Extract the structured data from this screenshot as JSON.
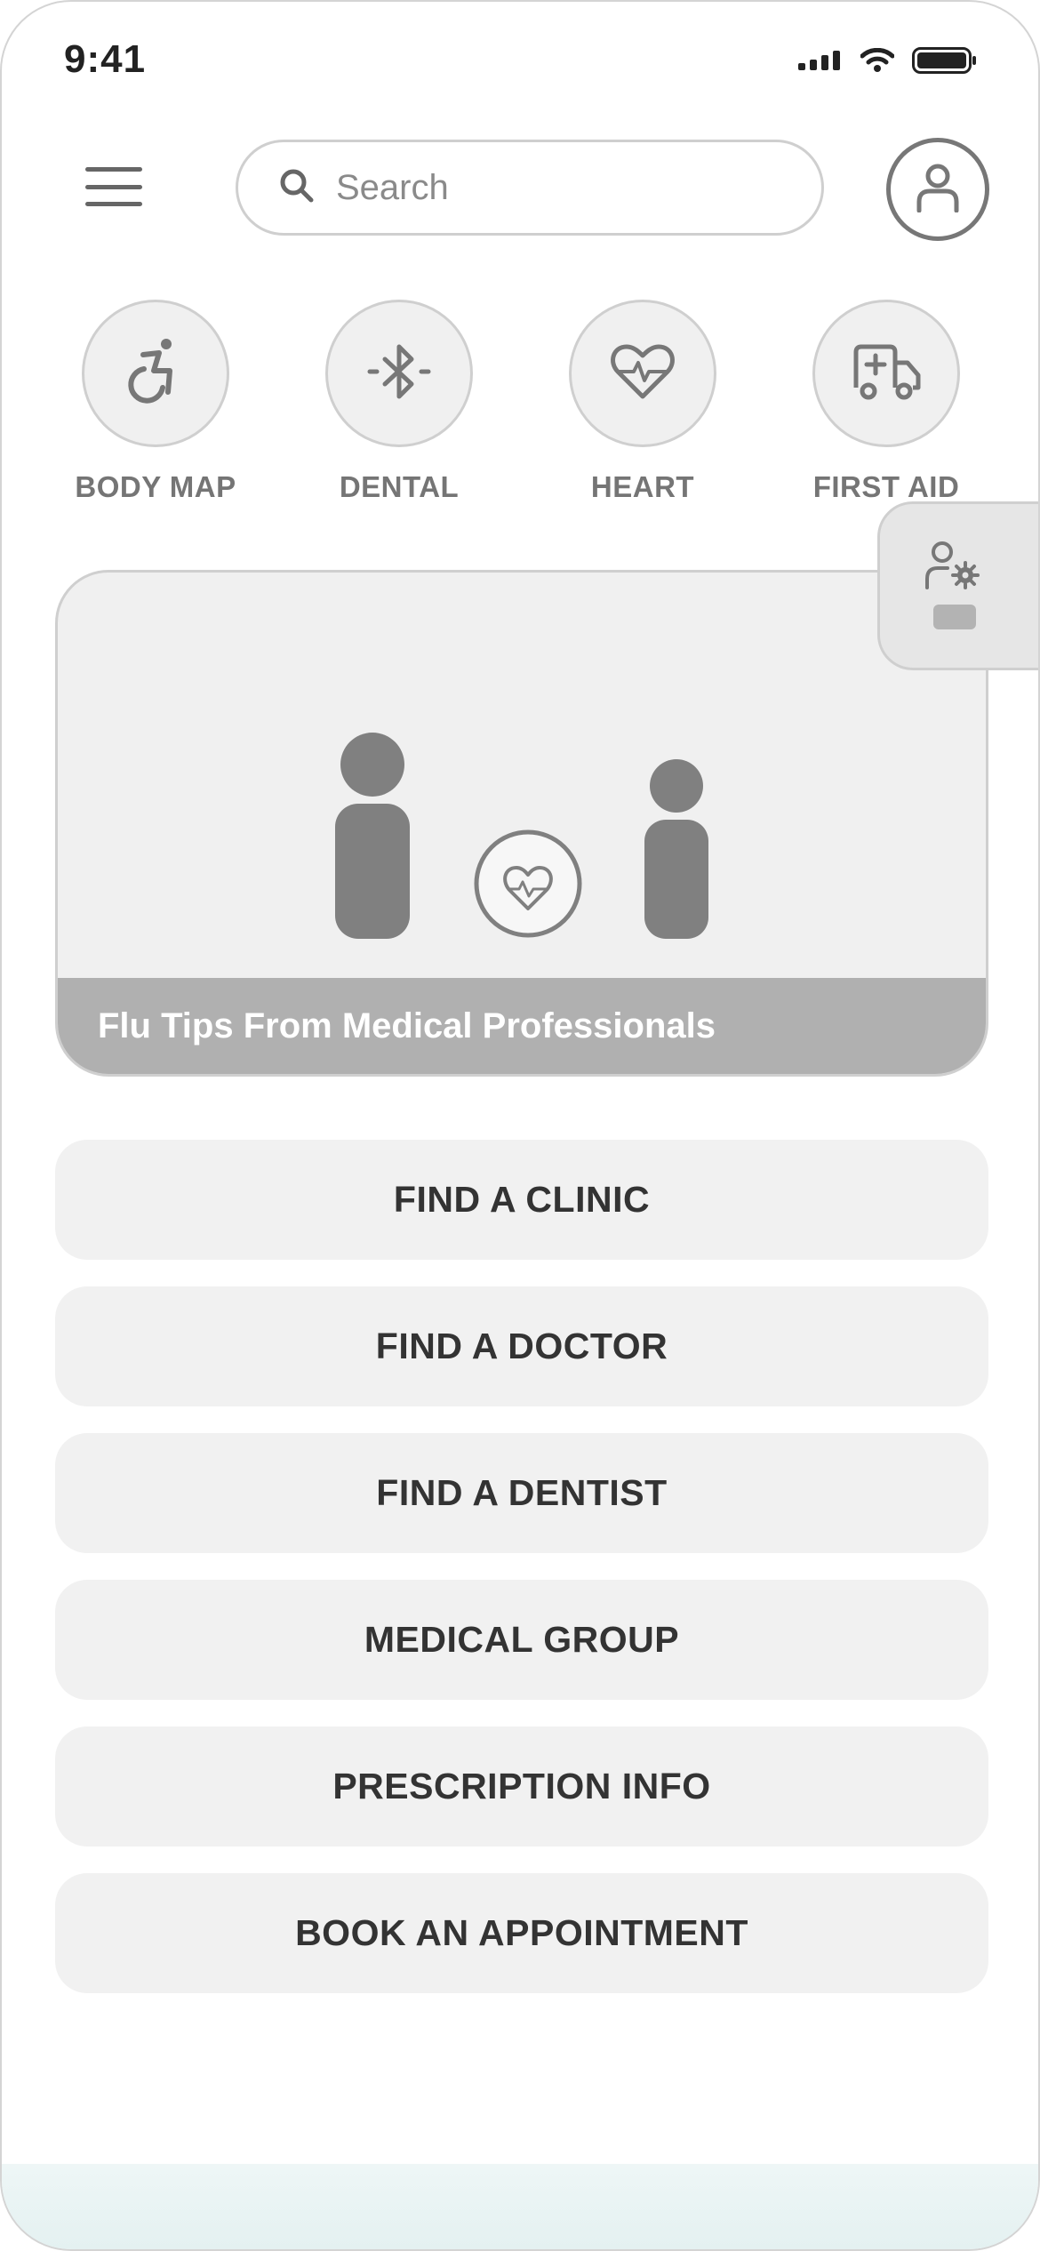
{
  "status_bar": {
    "time": "9:41",
    "icons": [
      "cellular-signal-icon",
      "wifi-icon",
      "battery-icon"
    ]
  },
  "header": {
    "menu_icon": "hamburger-menu-icon",
    "search": {
      "placeholder": "Search",
      "value": "",
      "icon": "search-icon"
    },
    "profile_icon": "user-icon"
  },
  "categories": [
    {
      "label": "BODY MAP",
      "icon": "accessibility-icon"
    },
    {
      "label": "DENTAL",
      "icon": "bluetooth-icon"
    },
    {
      "label": "HEART",
      "icon": "heart-pulse-icon"
    },
    {
      "label": "FIRST AID",
      "icon": "ambulance-icon"
    }
  ],
  "hero": {
    "caption": "Flu Tips From Medical Professionals",
    "illustration": [
      "person-figure",
      "heart-pulse-icon",
      "person-figure"
    ]
  },
  "admin_tab": {
    "icon": "user-settings-icon"
  },
  "actions": [
    {
      "label": "FIND A CLINIC"
    },
    {
      "label": "FIND A DOCTOR"
    },
    {
      "label": "FIND A DENTIST"
    },
    {
      "label": "MEDICAL GROUP"
    },
    {
      "label": "PRESCRIPTION INFO"
    },
    {
      "label": "BOOK AN APPOINTMENT"
    }
  ],
  "colors": {
    "icon_gray": "#777777",
    "card_fill": "#f0f0f0",
    "border": "#cfcfcf",
    "caption_bar": "#b0b0b0",
    "button_text": "#333333",
    "bottom_tint": "#e8f3f3"
  }
}
